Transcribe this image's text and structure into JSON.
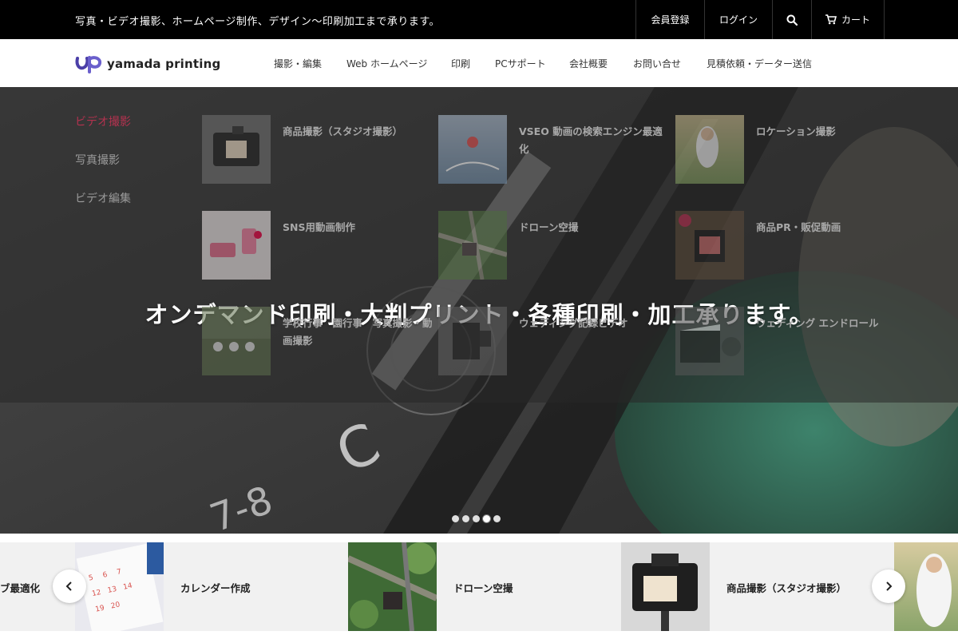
{
  "topbar": {
    "tagline": "写真・ビデオ撮影、ホームページ制作、デザイン〜印刷加工まで承ります。",
    "member": "会員登録",
    "login": "ログイン",
    "cart": "カート"
  },
  "header": {
    "logo_text": "yamada printing",
    "nav": [
      "撮影・編集",
      "Web ホームページ",
      "印刷",
      "PCサポート",
      "会社概要",
      "お問い合せ",
      "見積依頼・データー送信"
    ]
  },
  "mega": {
    "side": [
      "ビデオ撮影",
      "写真撮影",
      "ビデオ編集"
    ],
    "items": [
      "商品撮影（スタジオ撮影）",
      "VSEO 動画の検索エンジン最適化",
      "ロケーション撮影",
      "SNS用動画制作",
      "ドローン空撮",
      "商品PR・販促動画",
      "学校行事　園行事　写真撮影・動画撮影",
      "ウェディング記録ビデオ",
      "ウェディング エンドロール"
    ]
  },
  "hero": {
    "caption": "オンデマンド印刷・大判プリント・各種印刷・加工承ります。",
    "slide_count": 5,
    "active_slide": 4
  },
  "carousel": {
    "items": [
      "ブ最適化",
      "カレンダー作成",
      "ドローン空撮",
      "商品撮影（スタジオ撮影）"
    ]
  },
  "colors": {
    "topbar": "#000000",
    "active_side": "#b3324f",
    "card_bg": "#f1f1f1"
  }
}
